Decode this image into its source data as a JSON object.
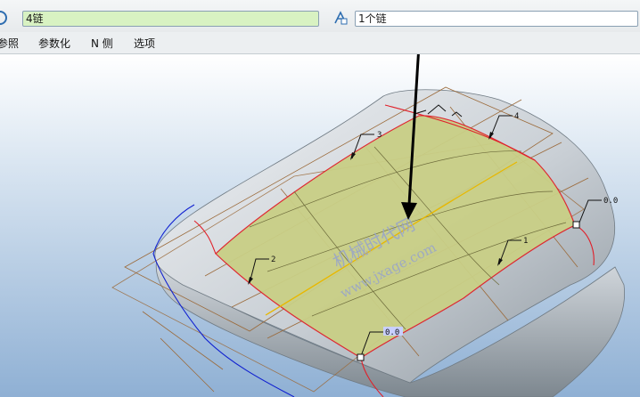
{
  "chain_collector": {
    "reference_field_value": "4链",
    "details_field_value": "1个链"
  },
  "tabs": [
    {
      "label": "参照"
    },
    {
      "label": "参数化"
    },
    {
      "label": "N 侧"
    },
    {
      "label": "选项"
    }
  ],
  "model_view": {
    "edge_labels": [
      "4",
      "3",
      "2",
      "1"
    ],
    "vertex_labels": [
      "0.0",
      "0.0"
    ]
  },
  "watermark": {
    "site_name": "机械时代网",
    "url": "www.jxage.com"
  },
  "colors": {
    "surface_fill": "#c9cf86",
    "boundary_red": "#e0202a",
    "guide_blue": "#1020d0",
    "axis_yellow": "#e8b800",
    "grid_brown": "#9b6a3a",
    "field_selected": "#d8f2c2"
  }
}
